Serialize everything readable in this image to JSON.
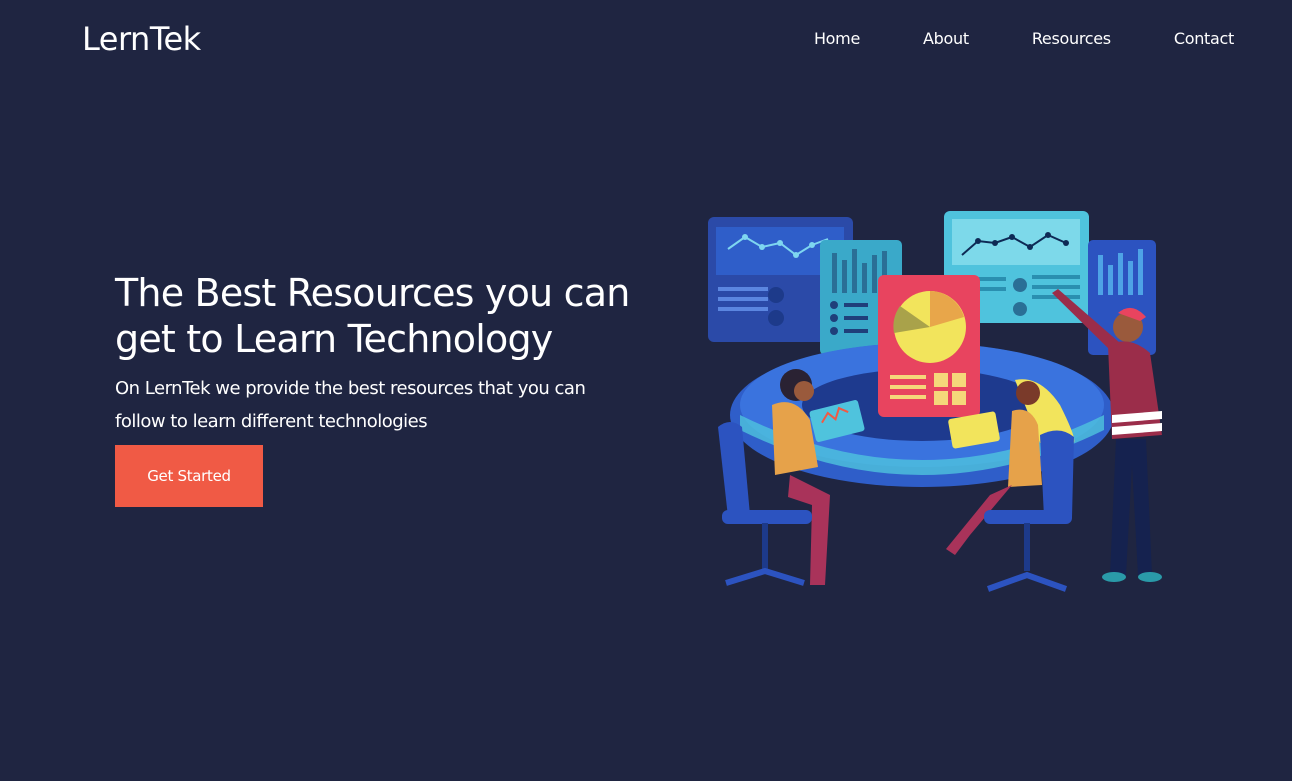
{
  "brand": {
    "name": "LernTek"
  },
  "nav": {
    "items": [
      {
        "label": "Home"
      },
      {
        "label": "About"
      },
      {
        "label": "Resources"
      },
      {
        "label": "Contact"
      }
    ]
  },
  "hero": {
    "title_line1": "The Best Resources you can",
    "title_line2": "get to Learn Technology",
    "subtitle": "On LernTek we provide the best resources that you can follow to learn different technologies",
    "cta_label": "Get Started"
  },
  "colors": {
    "background": "#1f2541",
    "accent": "#f05a45",
    "text": "#ffffff"
  },
  "illustration": {
    "icon": "team-meeting-illustration"
  }
}
